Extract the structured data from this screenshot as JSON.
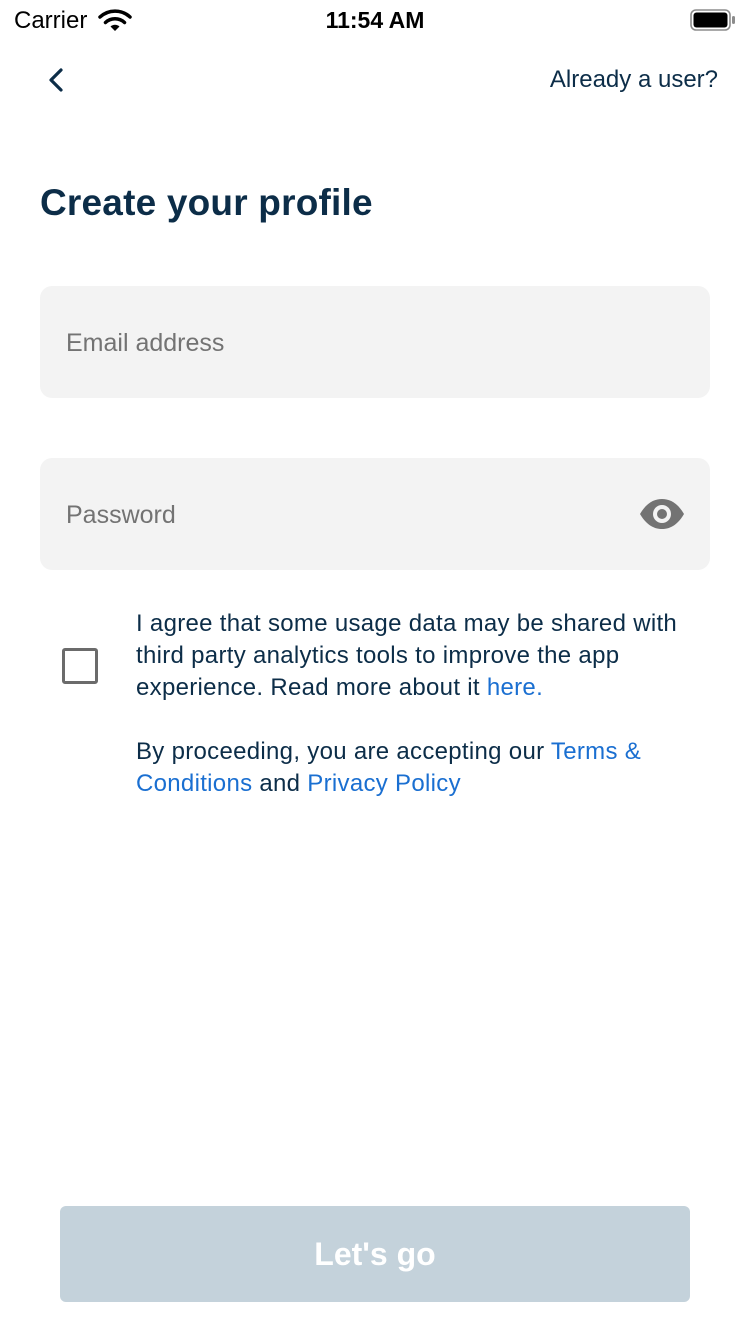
{
  "status_bar": {
    "carrier": "Carrier",
    "time": "11:54 AM",
    "icons": [
      "wifi-icon",
      "battery-icon"
    ]
  },
  "nav": {
    "back_icon": "chevron-left-icon",
    "already_user_label": "Already a user?"
  },
  "page": {
    "title": "Create your profile"
  },
  "form": {
    "email": {
      "placeholder": "Email address",
      "value": ""
    },
    "password": {
      "placeholder": "Password",
      "value": "",
      "toggle_icon": "eye-icon"
    },
    "consent": {
      "checked": false,
      "text": "I agree that some usage data may be shared with third party analytics tools to improve the app experience. Read more about it ",
      "link_label": "here."
    },
    "terms": {
      "prefix": "By proceeding, you are accepting our ",
      "terms_link": "Terms & Conditions",
      "conjunction": " and ",
      "privacy_link": "Privacy Policy"
    },
    "submit_label": "Let's go",
    "submit_enabled": false
  },
  "colors": {
    "primary_text": "#0c2d48",
    "link": "#1a6fd1",
    "field_bg": "#f3f3f3",
    "button_disabled_bg": "#c4d2db"
  }
}
